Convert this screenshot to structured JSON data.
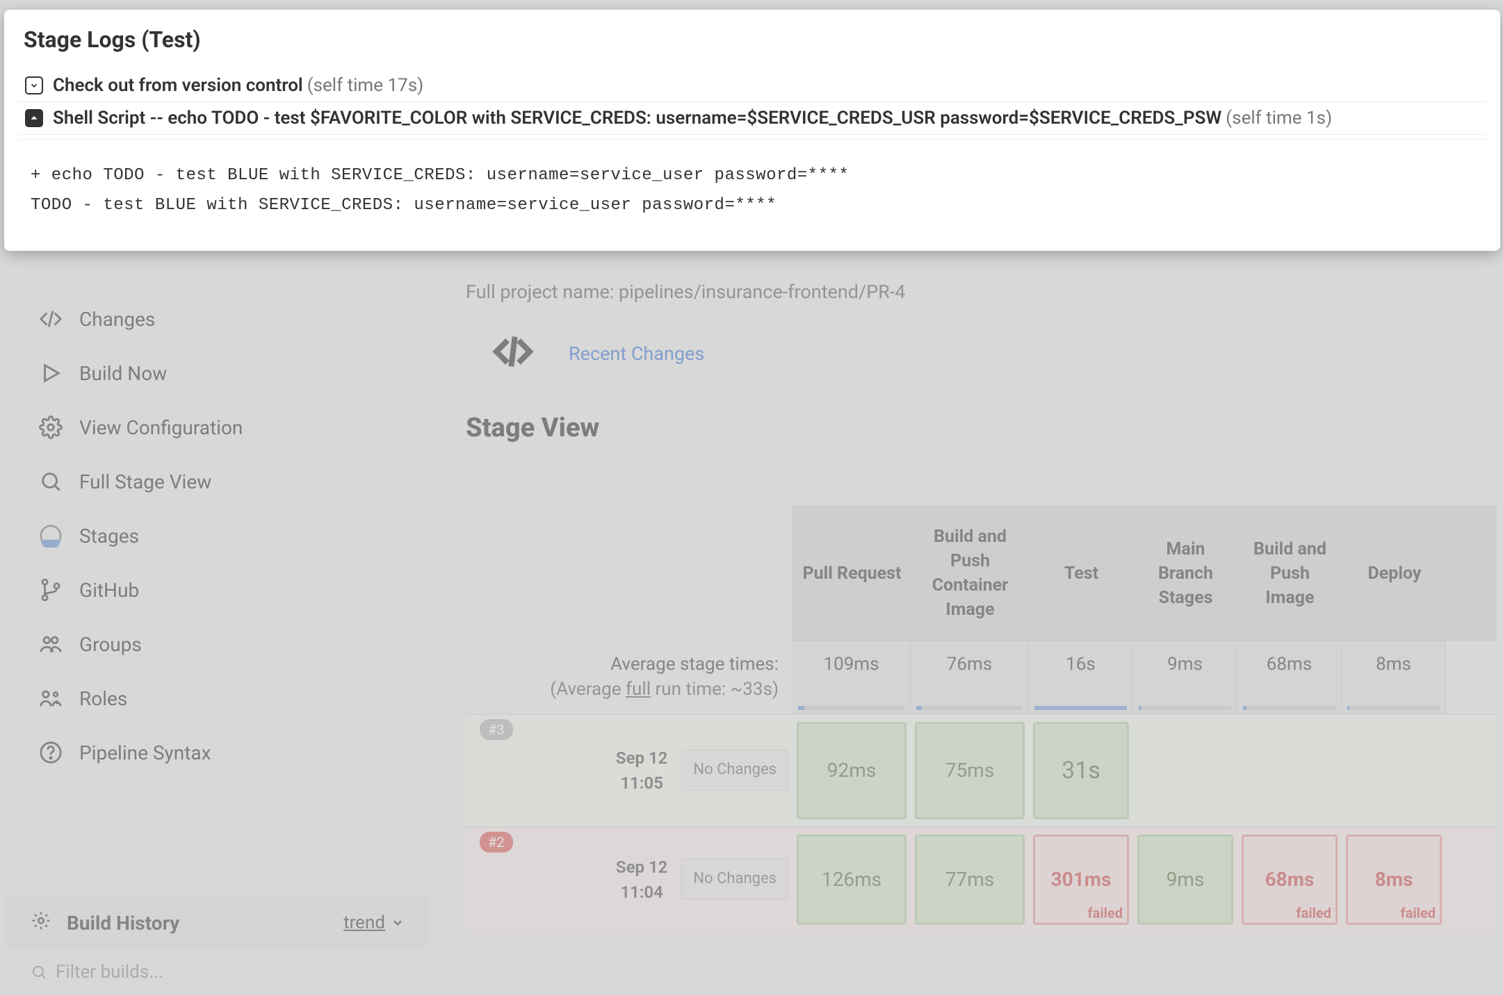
{
  "modal": {
    "title": "Stage Logs (Test)",
    "rows": [
      {
        "label": "Check out from version control",
        "sub": "(self time 17s)",
        "open": false
      },
      {
        "label": "Shell Script -- echo TODO - test $FAVORITE_COLOR with SERVICE_CREDS: username=$SERVICE_CREDS_USR password=$SERVICE_CREDS_PSW",
        "sub": "(self time 1s)",
        "open": true
      }
    ],
    "log_body": "+ echo TODO - test BLUE with SERVICE_CREDS: username=service_user password=****\nTODO - test BLUE with SERVICE_CREDS: username=service_user password=****"
  },
  "sidebar": {
    "items": [
      {
        "label": "Changes",
        "icon": "code"
      },
      {
        "label": "Build Now",
        "icon": "play"
      },
      {
        "label": "View Configuration",
        "icon": "gear"
      },
      {
        "label": "Full Stage View",
        "icon": "search"
      },
      {
        "label": "Stages",
        "icon": "ball"
      },
      {
        "label": "GitHub",
        "icon": "branch"
      },
      {
        "label": "Groups",
        "icon": "group"
      },
      {
        "label": "Roles",
        "icon": "roles"
      },
      {
        "label": "Pipeline Syntax",
        "icon": "help"
      }
    ],
    "build_history": {
      "title": "Build History",
      "trend": "trend",
      "filter_placeholder": "Filter builds..."
    }
  },
  "main": {
    "full_project_name": "Full project name: pipelines/insurance-frontend/PR-4",
    "recent_changes": "Recent Changes",
    "stage_view_title": "Stage View",
    "columns": [
      "Pull Request",
      "Build and Push Container Image",
      "Test",
      "Main Branch Stages",
      "Build and Push Image",
      "Deploy"
    ],
    "avg": {
      "line1": "Average stage times:",
      "line2_before": "(Average ",
      "line2_underlined": "full",
      "line2_after": " run time: ~33s)",
      "values": [
        "109ms",
        "76ms",
        "16s",
        "9ms",
        "68ms",
        "8ms"
      ],
      "fill": [
        6,
        5,
        100,
        3,
        4,
        2
      ]
    },
    "runs": [
      {
        "badge": "#3",
        "badge_style": "gray",
        "date_line1": "Sep 12",
        "date_line2": "11:05",
        "changes": "No Changes",
        "bg": "green",
        "cells": [
          {
            "v": "92ms",
            "s": "ok"
          },
          {
            "v": "75ms",
            "s": "ok"
          },
          {
            "v": "31s",
            "s": "ok",
            "big": true
          },
          {
            "v": "",
            "s": "blank"
          },
          {
            "v": "",
            "s": "blank"
          },
          {
            "v": "",
            "s": "blank"
          }
        ]
      },
      {
        "badge": "#2",
        "badge_style": "red",
        "date_line1": "Sep 12",
        "date_line2": "11:04",
        "changes": "No Changes",
        "bg": "red",
        "cells": [
          {
            "v": "126ms",
            "s": "ok"
          },
          {
            "v": "77ms",
            "s": "ok"
          },
          {
            "v": "301ms",
            "s": "fail",
            "status": "failed"
          },
          {
            "v": "9ms",
            "s": "ok"
          },
          {
            "v": "68ms",
            "s": "fail",
            "status": "failed"
          },
          {
            "v": "8ms",
            "s": "fail",
            "status": "failed"
          }
        ]
      }
    ]
  }
}
